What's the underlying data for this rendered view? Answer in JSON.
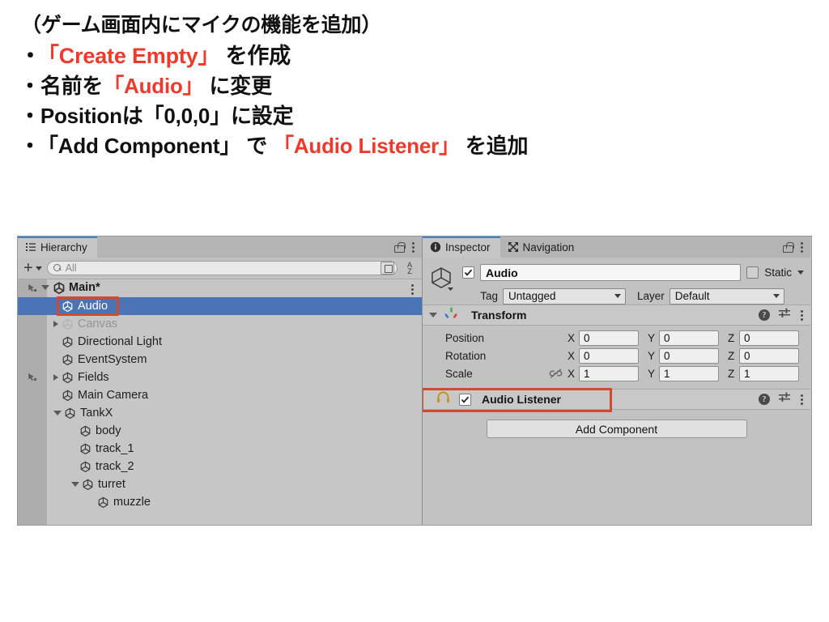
{
  "slide": {
    "lines": [
      {
        "id": "line-title",
        "parts": [
          {
            "text": "（ゲーム画面内にマイクの機能を追加）",
            "hl": false
          }
        ]
      },
      {
        "id": "line-create-empty",
        "bullet": "・",
        "parts": [
          {
            "text": "「Create Empty」",
            "hl": true
          },
          {
            "text": " を作成",
            "hl": false
          }
        ]
      },
      {
        "id": "line-rename",
        "bullet": "・",
        "parts": [
          {
            "text": "名前を",
            "hl": false
          },
          {
            "text": "「Audio」",
            "hl": true
          },
          {
            "text": " に変更",
            "hl": false
          }
        ]
      },
      {
        "id": "line-position",
        "bullet": "・",
        "parts": [
          {
            "text": "Positionは「0,0,0」に設定",
            "hl": false
          }
        ]
      },
      {
        "id": "line-add-component",
        "bullet": "・",
        "parts": [
          {
            "text": " 「Add Component」 で ",
            "hl": false
          },
          {
            "text": "「Audio Listener」",
            "hl": true
          },
          {
            "text": " を追加",
            "hl": false
          }
        ]
      }
    ],
    "plain": {
      "title": "（ゲーム画面内にマイクの機能を追加）",
      "l1_a": "「Create Empty」",
      "l1_b": " を作成",
      "l2_a": "名前を",
      "l2_b": "「Audio」",
      "l2_c": " に変更",
      "l3": "Positionは「0,0,0」に設定",
      "l4_a": "「Add Component」 で ",
      "l4_b": "「Audio Listener」",
      "l4_c": " を追加",
      "bullet": "・"
    },
    "highlight_color": "#f0392b",
    "text_color": "#111111"
  },
  "hierarchy": {
    "tab": {
      "label": "Hierarchy",
      "icon": "list-icon",
      "active": true
    },
    "lock_icon": "lock-icon",
    "menu_icon": "kebab-menu-icon",
    "toolbar": {
      "add_label": "+",
      "add_icon": "plus-icon",
      "search_placeholder": "All",
      "search_value": "",
      "search_icon": "search-icon",
      "popout_icon": "popout-icon",
      "sort_icon": "alpha-sort-icon",
      "sort_label_top": "A",
      "sort_label_bottom": "Z"
    },
    "scene": {
      "label": "Main*",
      "icon": "unity-scene-icon",
      "prefab_icon": "prefab-hand-icon",
      "expanded": true
    },
    "items": [
      {
        "name": "Audio",
        "indent": 1,
        "foldout": "none",
        "selected": true,
        "inactive": false,
        "highlighted": true
      },
      {
        "name": "Canvas",
        "indent": 1,
        "foldout": "closed",
        "selected": false,
        "inactive": true,
        "highlighted": false
      },
      {
        "name": "Directional Light",
        "indent": 1,
        "foldout": "none",
        "selected": false,
        "inactive": false,
        "highlighted": false
      },
      {
        "name": "EventSystem",
        "indent": 1,
        "foldout": "none",
        "selected": false,
        "inactive": false,
        "highlighted": false
      },
      {
        "name": "Fields",
        "indent": 1,
        "foldout": "closed",
        "selected": false,
        "inactive": false,
        "highlighted": false,
        "prefab": true
      },
      {
        "name": "Main Camera",
        "indent": 1,
        "foldout": "none",
        "selected": false,
        "inactive": false,
        "highlighted": false
      },
      {
        "name": "TankX",
        "indent": 1,
        "foldout": "open",
        "selected": false,
        "inactive": false,
        "highlighted": false
      },
      {
        "name": "body",
        "indent": 2,
        "foldout": "none",
        "selected": false,
        "inactive": false,
        "highlighted": false
      },
      {
        "name": "track_1",
        "indent": 2,
        "foldout": "none",
        "selected": false,
        "inactive": false,
        "highlighted": false
      },
      {
        "name": "track_2",
        "indent": 2,
        "foldout": "none",
        "selected": false,
        "inactive": false,
        "highlighted": false
      },
      {
        "name": "turret",
        "indent": 2,
        "foldout": "open",
        "selected": false,
        "inactive": false,
        "highlighted": false
      },
      {
        "name": "muzzle",
        "indent": 3,
        "foldout": "none",
        "selected": false,
        "inactive": false,
        "highlighted": false
      }
    ],
    "selection_color": "#4a74b5",
    "highlight_box_color": "#d4482c"
  },
  "inspector": {
    "tabs": [
      {
        "label": "Inspector",
        "icon": "info-icon",
        "active": true
      },
      {
        "label": "Navigation",
        "icon": "navigation-icon",
        "active": false
      }
    ],
    "lock_icon": "lock-icon",
    "menu_icon": "kebab-menu-icon",
    "object_header": {
      "icon": "gameobject-cube-icon",
      "enabled": true,
      "name": "Audio",
      "static_label": "Static",
      "static_checked": false,
      "tag_label": "Tag",
      "tag_value": "Untagged",
      "layer_label": "Layer",
      "layer_value": "Default"
    },
    "components": [
      {
        "id": "transform",
        "title": "Transform",
        "icon": "transform-axis-icon",
        "expanded": true,
        "highlighted": false,
        "has_checkbox": false,
        "help_icon": "help-icon",
        "preset_icon": "preset-icon",
        "menu_icon": "kebab-menu-icon",
        "rows": [
          {
            "label": "Position",
            "link": false,
            "axes": [
              {
                "axis": "X",
                "value": "0"
              },
              {
                "axis": "Y",
                "value": "0"
              },
              {
                "axis": "Z",
                "value": "0"
              }
            ]
          },
          {
            "label": "Rotation",
            "link": false,
            "axes": [
              {
                "axis": "X",
                "value": "0"
              },
              {
                "axis": "Y",
                "value": "0"
              },
              {
                "axis": "Z",
                "value": "0"
              }
            ]
          },
          {
            "label": "Scale",
            "link": true,
            "axes": [
              {
                "axis": "X",
                "value": "1"
              },
              {
                "axis": "Y",
                "value": "1"
              },
              {
                "axis": "Z",
                "value": "1"
              }
            ]
          }
        ]
      },
      {
        "id": "audio-listener",
        "title": "Audio Listener",
        "icon": "headphones-icon",
        "icon_color": "#c8941a",
        "expanded": false,
        "highlighted": true,
        "has_checkbox": true,
        "checked": true,
        "help_icon": "help-icon",
        "preset_icon": "preset-icon",
        "menu_icon": "kebab-menu-icon",
        "rows": []
      }
    ],
    "add_component_label": "Add Component",
    "highlight_box_color": "#d4482c"
  }
}
